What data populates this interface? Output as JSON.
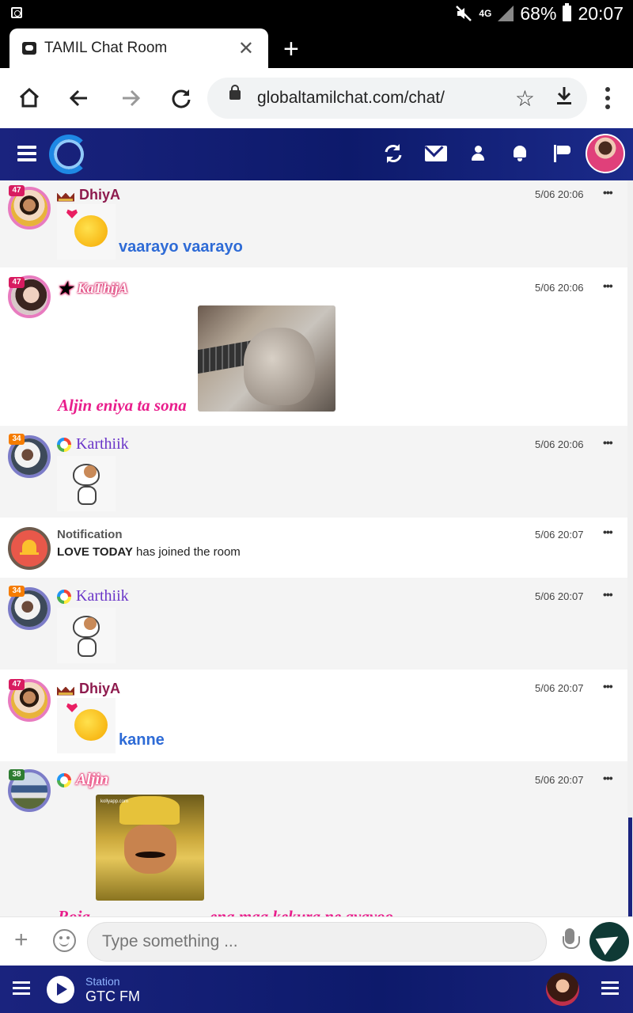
{
  "status_bar": {
    "battery": "68%",
    "time": "20:07",
    "network": "4G"
  },
  "browser": {
    "tab_title": "TAMIL Chat Room",
    "url": "globaltamilchat.com/chat/"
  },
  "messages": [
    {
      "level": "47",
      "username": "DhiyA",
      "time": "5/06 20:06",
      "text": "vaarayo vaarayo"
    },
    {
      "level": "47",
      "username": "KaThijA",
      "time": "5/06 20:06",
      "text": "Aljin eniya ta sona"
    },
    {
      "level": "34",
      "username": "Karthiik",
      "time": "5/06 20:06"
    },
    {
      "title": "Notification",
      "actor": "LOVE TODAY",
      "action": "has joined the room",
      "time": "5/06 20:07"
    },
    {
      "level": "34",
      "username": "Karthiik",
      "time": "5/06 20:07"
    },
    {
      "level": "47",
      "username": "DhiyA",
      "time": "5/06 20:07",
      "text": "kanne"
    },
    {
      "level": "38",
      "username": "Aljin",
      "time": "5/06 20:07",
      "text_before": "Roja",
      "text_after": "ena maa kekura ne ayayoo",
      "image_watermark": "kollyapp.com"
    }
  ],
  "more_label": "•••",
  "composer": {
    "placeholder": "Type something ..."
  },
  "player": {
    "label": "Station",
    "station": "GTC FM"
  },
  "colors": {
    "header": "#1a237e",
    "accent_blue": "#2e6bd6",
    "accent_pink": "#e91e8c",
    "send": "#0f3a35"
  }
}
